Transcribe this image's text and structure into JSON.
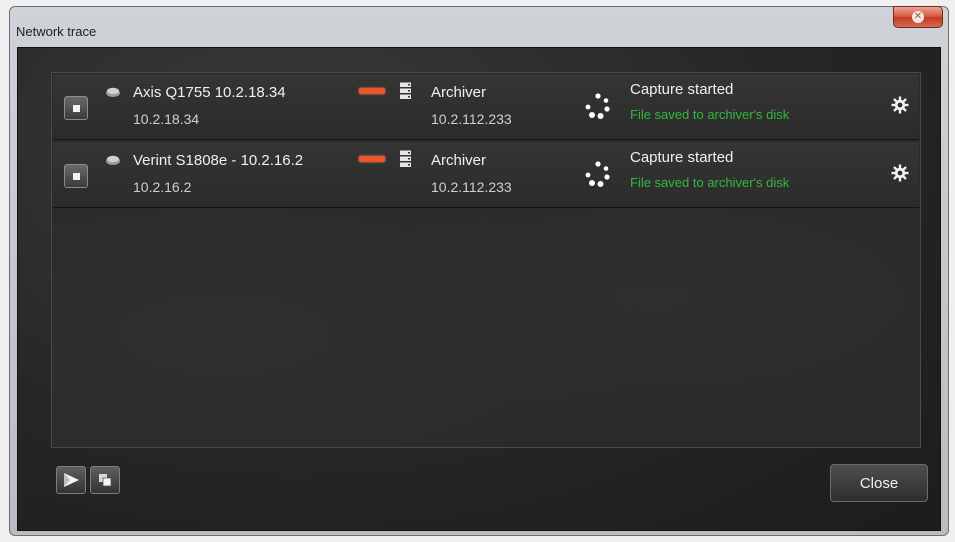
{
  "window": {
    "title": "Network trace"
  },
  "rows": [
    {
      "device_name": "Axis Q1755 10.2.18.34",
      "device_ip": "10.2.18.34",
      "archiver_name": "Archiver",
      "archiver_ip": "10.2.112.233",
      "status": "Capture started",
      "substatus": "File saved to archiver's disk"
    },
    {
      "device_name": "Verint S1808e - 10.2.16.2",
      "device_ip": "10.2.16.2",
      "archiver_name": "Archiver",
      "archiver_ip": "10.2.112.233",
      "status": "Capture started",
      "substatus": "File saved to archiver's disk"
    }
  ],
  "footer": {
    "close_label": "Close"
  },
  "colors": {
    "success_text": "#32b83e",
    "link_accent": "#e8562a",
    "titlebar_close": "#d6573f"
  },
  "icons": {
    "stop": "stop-icon",
    "camera": "camera-icon",
    "link": "connection-icon",
    "server": "server-icon",
    "spinner": "loading-spinner-icon",
    "gear": "gear-icon",
    "play": "play-icon",
    "copy": "copy-icon",
    "close": "close-icon"
  }
}
